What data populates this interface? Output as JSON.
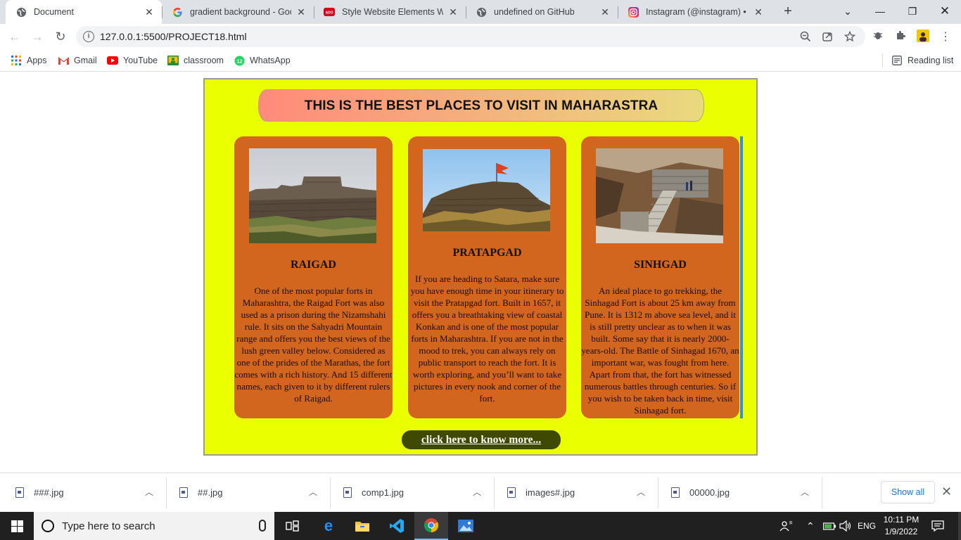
{
  "browser": {
    "tabs": [
      {
        "title": "Document",
        "icon": "globe-icon",
        "active": true
      },
      {
        "title": "gradient background - Googl",
        "icon": "google-icon",
        "active": false
      },
      {
        "title": "Style Website Elements With",
        "icon": "youtube-icon",
        "active": false
      },
      {
        "title": "undefined on GitHub",
        "icon": "globe-icon",
        "active": false
      },
      {
        "title": "Instagram (@instagram) • Ins",
        "icon": "instagram-icon",
        "active": false
      }
    ],
    "url": "127.0.0.1:5500/PROJECT18.html",
    "bookmarks": [
      {
        "label": "Apps",
        "icon": "apps-grid-icon"
      },
      {
        "label": "Gmail",
        "icon": "gmail-icon"
      },
      {
        "label": "YouTube",
        "icon": "youtube-icon"
      },
      {
        "label": "classroom",
        "icon": "classroom-icon"
      },
      {
        "label": "WhatsApp",
        "icon": "whatsapp-icon"
      }
    ],
    "reading_list": "Reading list"
  },
  "page": {
    "heading": "THIS IS THE BEST PLACES TO VISIT IN MAHARASTRA",
    "cards": [
      {
        "name": "RAIGAD",
        "image": "raigad-fort-photo",
        "description": "One of the most popular forts in Maharashtra, the Raigad Fort was also used as a prison during the Nizamshahi rule. It sits on the Sahyadri Mountain range and offers you the best views of the lush green valley below. Considered as one of the prides of the Marathas, the fort comes with a rich history. And 15 different names, each given to it by different rulers of Raigad."
      },
      {
        "name": "PRATAPGAD",
        "image": "pratapgad-fort-photo",
        "description": "If you are heading to Satara, make sure you have enough time in your itinerary to visit the Pratapgad fort. Built in 1657, it offers you a breathtaking view of coastal Konkan and is one of the most popular forts in Maharashtra. If you are not in the mood to trek, you can always rely on public transport to reach the fort. It is worth exploring, and you’ll want to take pictures in every nook and corner of the fort."
      },
      {
        "name": "SINHGAD",
        "image": "sinhgad-fort-photo",
        "description": "An ideal place to go trekking, the Sinhagad Fort is about 25 km away from Pune. It is 1312 m above sea level, and it is still pretty unclear as to when it was built. Some say that it is nearly 2000-years-old. The Battle of Sinhagad 1670, an important war, was fought from here. Apart from that, the fort has witnessed numerous battles through centuries. So if you wish to be taken back in time, visit Sinhagad fort."
      }
    ],
    "more_link": "click here to know more...",
    "colors": {
      "background": "#eaff00",
      "card": "#d2661e",
      "button": "#3f4a00"
    }
  },
  "downloads": {
    "files": [
      "###.jpg",
      "##.jpg",
      "comp1.jpg",
      "images#.jpg",
      "00000.jpg"
    ],
    "show_all": "Show all"
  },
  "taskbar": {
    "search_placeholder": "Type here to search",
    "language": "ENG",
    "time": "10:11 PM",
    "date": "1/9/2022"
  }
}
